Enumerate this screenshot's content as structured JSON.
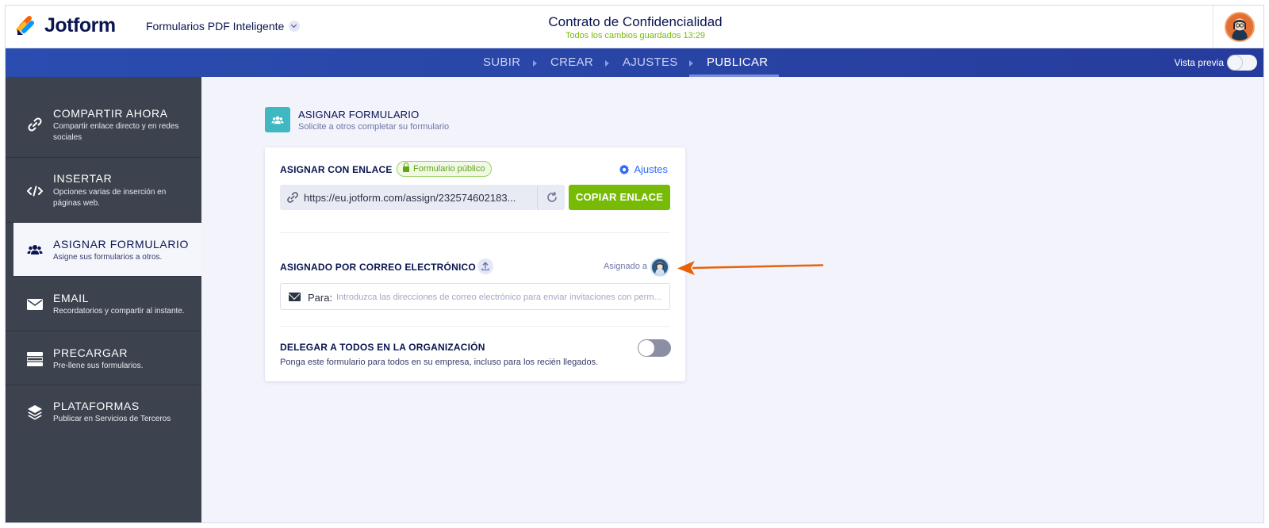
{
  "header": {
    "brand": "Jotform",
    "product": "Formularios PDF Inteligente",
    "doc_title": "Contrato de Confidencialidad",
    "save_status": "Todos los cambios guardados 13:29"
  },
  "nav": {
    "steps": [
      "SUBIR",
      "CREAR",
      "AJUSTES",
      "PUBLICAR"
    ],
    "active_step": "PUBLICAR",
    "preview_label": "Vista previa",
    "preview_on": false
  },
  "sidebar": {
    "items": [
      {
        "title": "COMPARTIR AHORA",
        "desc": "Compartir enlace directo y en redes sociales",
        "icon": "link-icon"
      },
      {
        "title": "INSERTAR",
        "desc": "Opciones varias de inserción en páginas web.",
        "icon": "code-icon"
      },
      {
        "title": "ASIGNAR FORMULARIO",
        "desc": "Asigne sus formularios a otros.",
        "icon": "users-icon"
      },
      {
        "title": "EMAIL",
        "desc": "Recordatorios y compartir al instante.",
        "icon": "envelope-icon"
      },
      {
        "title": "PRECARGAR",
        "desc": "Pre-llene sus formularios.",
        "icon": "prefill-icon"
      },
      {
        "title": "PLATAFORMAS",
        "desc": "Publicar en Servicios de Terceros",
        "icon": "layers-icon"
      }
    ],
    "active_index": 2
  },
  "main": {
    "section_title": "ASIGNAR FORMULARIO",
    "section_subtitle": "Solicite a otros completar su formulario",
    "assign_link": {
      "label": "ASIGNAR CON ENLACE",
      "badge": "Formulario público",
      "settings": "Ajustes",
      "url": "https://eu.jotform.com/assign/232574602183...",
      "copy_button": "COPIAR ENLACE"
    },
    "assign_email": {
      "label": "ASIGNADO POR CORREO ELECTRÓNICO",
      "assigned_to": "Asignado a",
      "to_label": "Para:",
      "placeholder": "Introduzca las direcciones de correo electrónico para enviar invitaciones con perm..."
    },
    "delegate": {
      "label": "DELEGAR A TODOS EN LA ORGANIZACIÓN",
      "desc": "Ponga este formulario para todos en su empresa, incluso para los recién llegados.",
      "enabled": false
    }
  },
  "colors": {
    "brand_navy": "#0a1551",
    "nav_blue": "#2b4db0",
    "sidebar_dark": "#3d434e",
    "accent_green": "#78bb07",
    "link_blue": "#2e69ff",
    "teal": "#3fb8c2",
    "annotation_orange": "#e8620a"
  }
}
